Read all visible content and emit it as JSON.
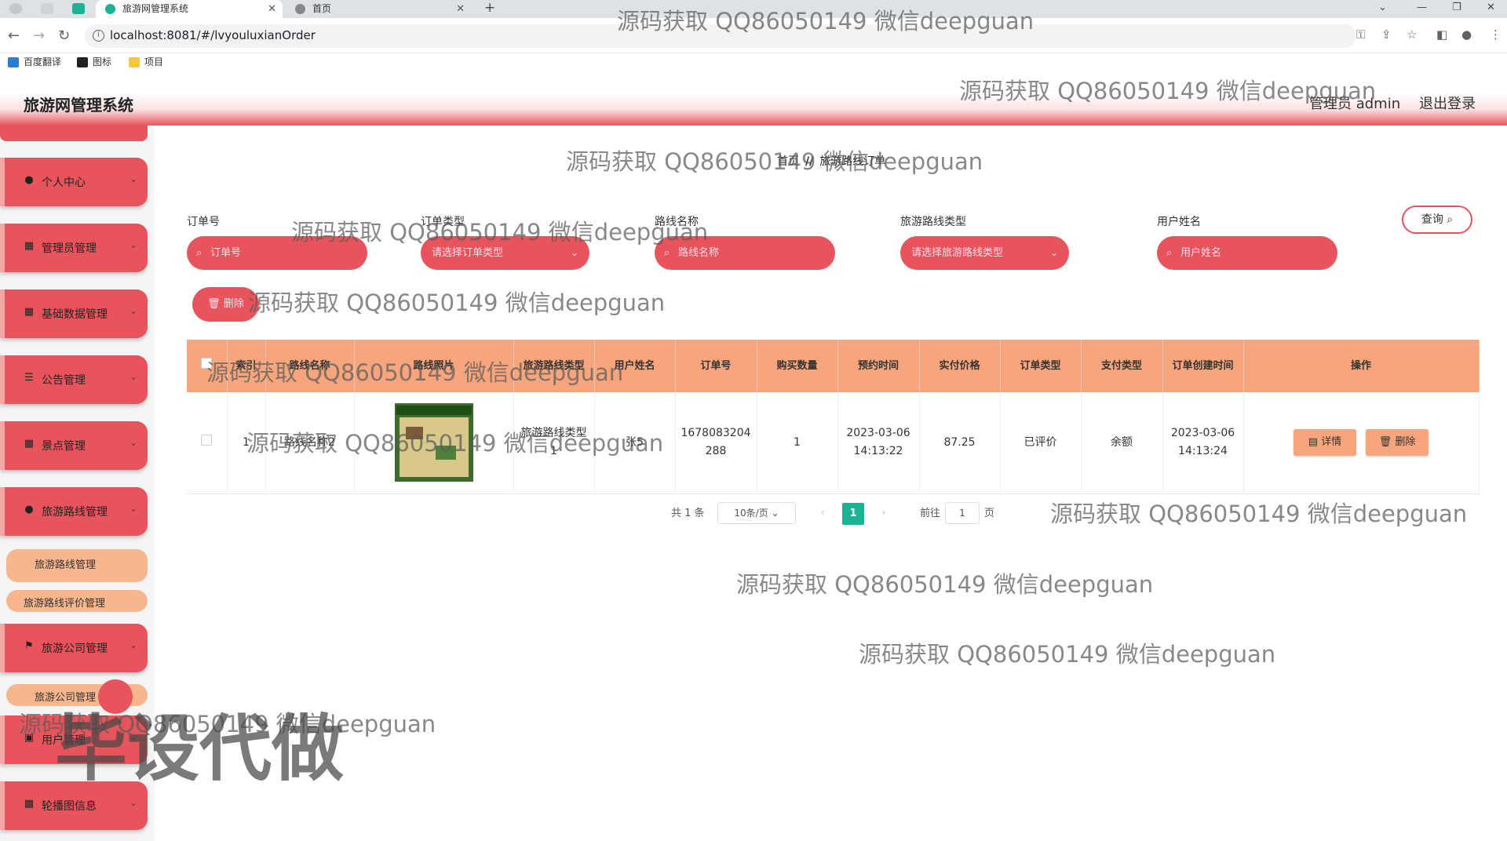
{
  "browser": {
    "tabs": [
      {
        "title": "旅游网管理系统",
        "active": true
      },
      {
        "title": "首页",
        "active": false
      }
    ],
    "new_tab": "+",
    "url": "localhost:8081/#/lvyouluxianOrder",
    "bookmarks": [
      "百度翻译",
      "图标",
      "项目"
    ]
  },
  "header": {
    "title": "旅游网管理系统",
    "user": "管理员 admin",
    "logout": "退出登录"
  },
  "sidebar": {
    "menus": [
      {
        "label": "个人中心",
        "icon": "user-icon"
      },
      {
        "label": "管理员管理",
        "icon": "grid-icon"
      },
      {
        "label": "基础数据管理",
        "icon": "grid-icon"
      },
      {
        "label": "公告管理",
        "icon": "list-icon"
      },
      {
        "label": "景点管理",
        "icon": "grid-icon"
      },
      {
        "label": "旅游路线管理",
        "icon": "user-icon"
      },
      {
        "label": "旅游公司管理",
        "icon": "flag-icon"
      },
      {
        "label": "用户管理",
        "icon": "card-icon"
      },
      {
        "label": "轮播图信息",
        "icon": "image-icon"
      }
    ],
    "submenus": [
      "旅游路线管理",
      "旅游路线评价管理",
      "旅游公司管理"
    ]
  },
  "breadcrumb": {
    "home": "首页",
    "sep": "//",
    "current": "旅游路线订单"
  },
  "filters": [
    {
      "label": "订单号",
      "placeholder": "订单号",
      "kind": "input"
    },
    {
      "label": "订单类型",
      "placeholder": "请选择订单类型",
      "kind": "select"
    },
    {
      "label": "路线名称",
      "placeholder": "路线名称",
      "kind": "input"
    },
    {
      "label": "旅游路线类型",
      "placeholder": "请选择旅游路线类型",
      "kind": "select"
    },
    {
      "label": "用户姓名",
      "placeholder": "用户姓名",
      "kind": "input"
    }
  ],
  "query_button": "查询",
  "batch_delete_button": "删除",
  "table": {
    "columns": [
      "索引",
      "路线名称",
      "路线照片",
      "旅游路线类型",
      "用户姓名",
      "订单号",
      "购买数量",
      "预约时间",
      "实付价格",
      "订单类型",
      "支付类型",
      "订单创建时间",
      "操作"
    ],
    "rows": [
      {
        "index": "1",
        "route_name": "路线名称2",
        "route_type": "旅游路线类型1",
        "user_name": "张5",
        "order_no": "1678083204288",
        "quantity": "1",
        "booking_time": "2023-03-06 14:13:22",
        "price": "87.25",
        "order_type": "已评价",
        "pay_type": "余额",
        "created_time": "2023-03-06 14:13:24",
        "detail_button": "详情",
        "delete_button": "删除"
      }
    ]
  },
  "pagination": {
    "total": "共 1 条",
    "page_size": "10条/页",
    "current_page": "1",
    "goto_prefix": "前往",
    "goto_value": "1",
    "goto_suffix": "页"
  },
  "watermark": {
    "text": "源码获取 QQ86050149 微信deepguan",
    "big": "毕设代做"
  },
  "colors": {
    "accent": "#e8545c",
    "table_header": "#f6a57c",
    "pager_active": "#1ab394"
  }
}
